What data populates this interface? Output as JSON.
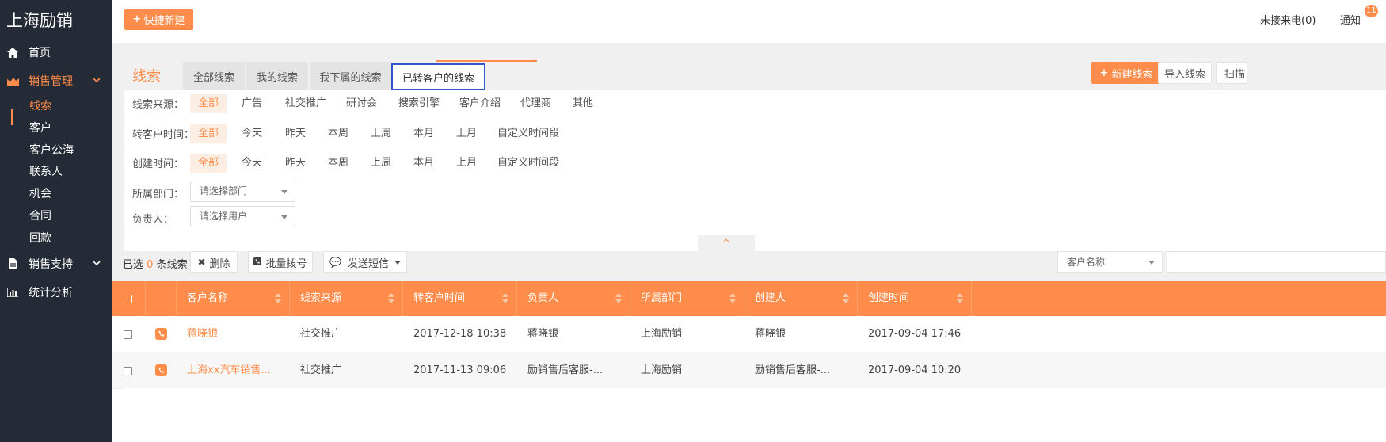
{
  "app": {
    "brand": "上海励销"
  },
  "sidebar": {
    "items": [
      {
        "label": "首页",
        "icon": "home-icon"
      },
      {
        "label": "销售管理",
        "icon": "chart-area-icon"
      },
      {
        "label": "销售支持",
        "icon": "file-icon"
      },
      {
        "label": "统计分析",
        "icon": "bar-chart-icon"
      }
    ],
    "sales_sub": [
      "线索",
      "客户",
      "客户公海",
      "联系人",
      "机会",
      "合同",
      "回款"
    ]
  },
  "topbar": {
    "quick_new": "快捷新建",
    "missed_calls": "未接来电(0)",
    "notify": "通知",
    "notify_count": "11"
  },
  "panel": {
    "title": "线索",
    "tabs": [
      "全部线索",
      "我的线索",
      "我下属的线索",
      "已转客户的线索"
    ],
    "buttons": {
      "new_lead": "新建线索",
      "import": "导入线索",
      "scan": "扫描"
    }
  },
  "filters": {
    "source": {
      "label": "线索来源：",
      "options": [
        "全部",
        "广告",
        "社交推广",
        "研讨会",
        "搜索引擎",
        "客户介绍",
        "代理商",
        "其他"
      ]
    },
    "convert_time": {
      "label": "转客户时间：",
      "options": [
        "全部",
        "今天",
        "昨天",
        "本周",
        "上周",
        "本月",
        "上月",
        "自定义时间段"
      ]
    },
    "create_time": {
      "label": "创建时间：",
      "options": [
        "全部",
        "今天",
        "昨天",
        "本周",
        "上周",
        "本月",
        "上月",
        "自定义时间段"
      ]
    },
    "dept": {
      "label": "所属部门：",
      "placeholder": "请选择部门"
    },
    "owner": {
      "label": "负责人：",
      "placeholder": "请选择用户"
    },
    "collapse": "^"
  },
  "toolbar": {
    "selected_prefix": "已选",
    "selected_count": "0",
    "selected_suffix": "条线索",
    "delete": "删除",
    "batch_dial": "批量拨号",
    "send_sms": "发送短信",
    "search_field": "客户名称"
  },
  "table": {
    "columns": [
      "客户名称",
      "线索来源",
      "转客户时间",
      "负责人",
      "所属部门",
      "创建人",
      "创建时间"
    ],
    "rows": [
      [
        "蒋晓银",
        "社交推广",
        "2017-12-18 10:38",
        "蒋晓银",
        "上海励销",
        "蒋晓银",
        "2017-09-04 17:46"
      ],
      [
        "上海xx汽车销售...",
        "社交推广",
        "2017-11-13 09:06",
        "励销售后客服-...",
        "上海励销",
        "励销售后客服-...",
        "2017-09-04 10:20"
      ]
    ]
  },
  "colors": {
    "accent": "#ff8c4a",
    "sidebar": "#252b36",
    "tab_highlight": "#3355c8"
  }
}
